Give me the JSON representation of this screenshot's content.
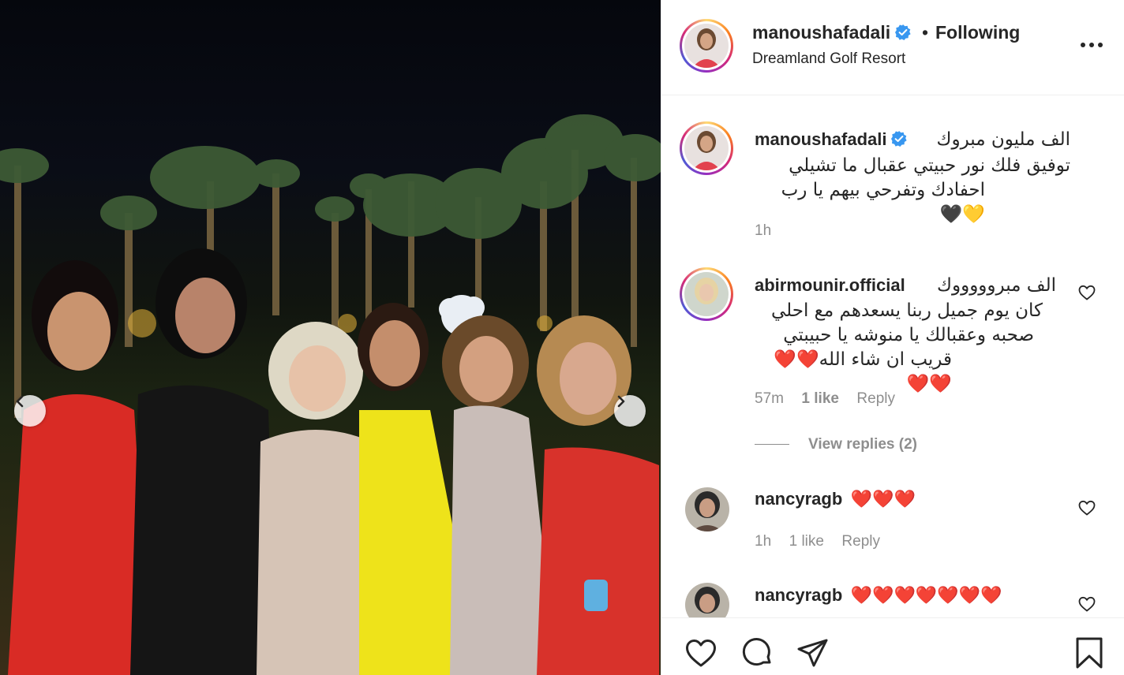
{
  "post": {
    "username": "manoushafadali",
    "follow_dot": "•",
    "follow_label": "Following",
    "location": "Dreamland Golf Resort"
  },
  "caption": {
    "username": "manoushafadali",
    "line1": "الف مليون مبروك",
    "line2": "توفيق فلك نور حبيتي عقبال ما تشيلي",
    "line3": "احفادك وتفرحي بيهم يا رب 💛🖤",
    "time": "1h"
  },
  "comments": [
    {
      "username": "abirmounir.official",
      "line1": "الف مبروووووك",
      "line2": "كان يوم جميل ربنا يسعدهم مع احلي",
      "line3": "صحبه وعقبالك يا منوشه يا حبيبتي",
      "line4": "قريب ان شاء الله❤️❤️❤️❤️",
      "time": "57m",
      "likes": "1 like",
      "reply": "Reply",
      "view_replies": "View replies (2)"
    },
    {
      "username": "nancyragb",
      "text": "❤️❤️❤️",
      "time": "1h",
      "likes": "1 like",
      "reply": "Reply"
    },
    {
      "username": "nancyragb",
      "text": "❤️❤️❤️❤️❤️❤️❤️"
    }
  ],
  "icons": {
    "verified": "verified-badge-icon",
    "more": "more-options-icon",
    "like": "heart-icon",
    "comment": "comment-icon",
    "share": "share-icon",
    "save": "bookmark-icon",
    "prev": "chevron-left-icon",
    "next": "chevron-right-icon"
  },
  "colors": {
    "text": "#262626",
    "secondary": "#8e8e8e",
    "verified": "#3897f0",
    "heart": "#ed4956",
    "border": "#efefef"
  }
}
